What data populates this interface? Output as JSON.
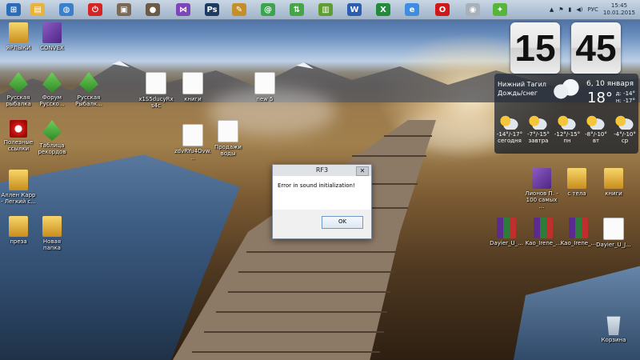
{
  "taskbar": {
    "pinned": [
      {
        "name": "windows-start-icon",
        "color": "#2b6cb8",
        "glyph": "⊞"
      },
      {
        "name": "file-explorer-icon",
        "color": "#e7b33c",
        "glyph": "▤"
      },
      {
        "name": "store-icon",
        "color": "#3a7fc9",
        "glyph": "◍"
      },
      {
        "name": "power-icon",
        "color": "#d42424",
        "glyph": "⏻"
      },
      {
        "name": "photo-app-icon",
        "color": "#7a6a55",
        "glyph": "▣"
      },
      {
        "name": "camera-icon",
        "color": "#6b5a45",
        "glyph": "●"
      },
      {
        "name": "visual-studio-icon",
        "color": "#7d47b8",
        "glyph": "⋈"
      },
      {
        "name": "photoshop-icon",
        "color": "#1d3a63",
        "glyph": "Ps"
      },
      {
        "name": "paint-icon",
        "color": "#c48f2a",
        "glyph": "✎"
      },
      {
        "name": "mail-agent-icon",
        "color": "#3aa54c",
        "glyph": "@"
      },
      {
        "name": "network-icon",
        "color": "#45a647",
        "glyph": "⇅"
      },
      {
        "name": "image-viewer-icon",
        "color": "#5e9d2f",
        "glyph": "▥"
      },
      {
        "name": "word-icon",
        "color": "#2b5db3",
        "glyph": "W"
      },
      {
        "name": "excel-icon",
        "color": "#218b3a",
        "glyph": "X"
      },
      {
        "name": "internet-explorer-icon",
        "color": "#3f8de0",
        "glyph": "e"
      },
      {
        "name": "opera-icon",
        "color": "#d01818",
        "glyph": "O"
      },
      {
        "name": "disc-icon",
        "color": "#a8b1bb",
        "glyph": "◉"
      },
      {
        "name": "butterfly-icon",
        "color": "#57b53c",
        "glyph": "✦"
      }
    ],
    "tray": {
      "language": "РУС",
      "time": "15:45",
      "date": "10.01.2015"
    }
  },
  "desktop": {
    "icons": [
      {
        "name": "desktop-icon-shortcuts",
        "label": "ЯРЛЫКИ",
        "type": "folder"
      },
      {
        "name": "desktop-icon-convex",
        "label": "CONVEX",
        "type": "vs"
      },
      {
        "name": "desktop-icon-fishing",
        "label": "Русская рыбалка",
        "type": "game"
      },
      {
        "name": "desktop-icon-forum",
        "label": "Форум Русско...",
        "type": "green"
      },
      {
        "name": "desktop-icon-fishing-2",
        "label": "Русская Рыбалк...",
        "type": "green"
      },
      {
        "name": "desktop-icon-file-1",
        "label": "x1S5ducyRxs4c",
        "type": "spreadsheet"
      },
      {
        "name": "desktop-icon-books-doc",
        "label": "книги",
        "type": "doc"
      },
      {
        "name": "desktop-icon-new-doc",
        "label": "new 5",
        "type": "doc"
      },
      {
        "name": "desktop-icon-useful-links",
        "label": "Полезные ссылки",
        "type": "opera"
      },
      {
        "name": "desktop-icon-records",
        "label": "Таблица рекордов",
        "type": "game"
      },
      {
        "name": "desktop-icon-image-file",
        "label": "zdvRYu4Ovw...",
        "type": "doc"
      },
      {
        "name": "desktop-icon-text-file",
        "label": "Продажи воды",
        "type": "doc"
      },
      {
        "name": "desktop-icon-allen-carr",
        "label": "Аллен Карр - Легкий с...",
        "type": "folder"
      },
      {
        "name": "desktop-icon-preza",
        "label": "преза",
        "type": "folder"
      },
      {
        "name": "desktop-icon-new-folder",
        "label": "Новая папка",
        "type": "folder"
      },
      {
        "name": "desktop-icon-lionov",
        "label": "Лионов П. - 100 самых ...",
        "type": "vs"
      },
      {
        "name": "desktop-icon-from-body",
        "label": "с тела",
        "type": "folder"
      },
      {
        "name": "desktop-icon-books-folder",
        "label": "книги",
        "type": "folder"
      },
      {
        "name": "desktop-icon-dayier-1",
        "label": "Dayier_U_...",
        "type": "winrar"
      },
      {
        "name": "desktop-icon-kao-1",
        "label": "Kao_Irene_...",
        "type": "winrar"
      },
      {
        "name": "desktop-icon-kao-2",
        "label": "Kao_Irene_...",
        "type": "winrar"
      },
      {
        "name": "desktop-icon-dayier-2",
        "label": "Dayier_U_J...",
        "type": "doc"
      },
      {
        "name": "desktop-icon-recycle-bin",
        "label": "Корзина",
        "type": "bin"
      }
    ]
  },
  "clock_gadget": {
    "hours": "15",
    "minutes": "45",
    "city": "Нижний Тагил",
    "condition": "Дождь/снег",
    "date": "6, 10 января",
    "temperature": "18°",
    "day_range": "д: -14°",
    "night_range": "н: -17°",
    "forecast": [
      {
        "temp": "-14°/-17°",
        "day": "сегодня"
      },
      {
        "temp": "-7°/-15°",
        "day": "завтра"
      },
      {
        "temp": "-12°/-15°",
        "day": "пн"
      },
      {
        "temp": "-8°/-10°",
        "day": "вт"
      },
      {
        "temp": "-4°/-10°",
        "day": "ср"
      }
    ]
  },
  "dialog": {
    "title": "RF3",
    "message": "Error in sound initialization!",
    "ok_label": "OK",
    "close_label": "✕"
  }
}
